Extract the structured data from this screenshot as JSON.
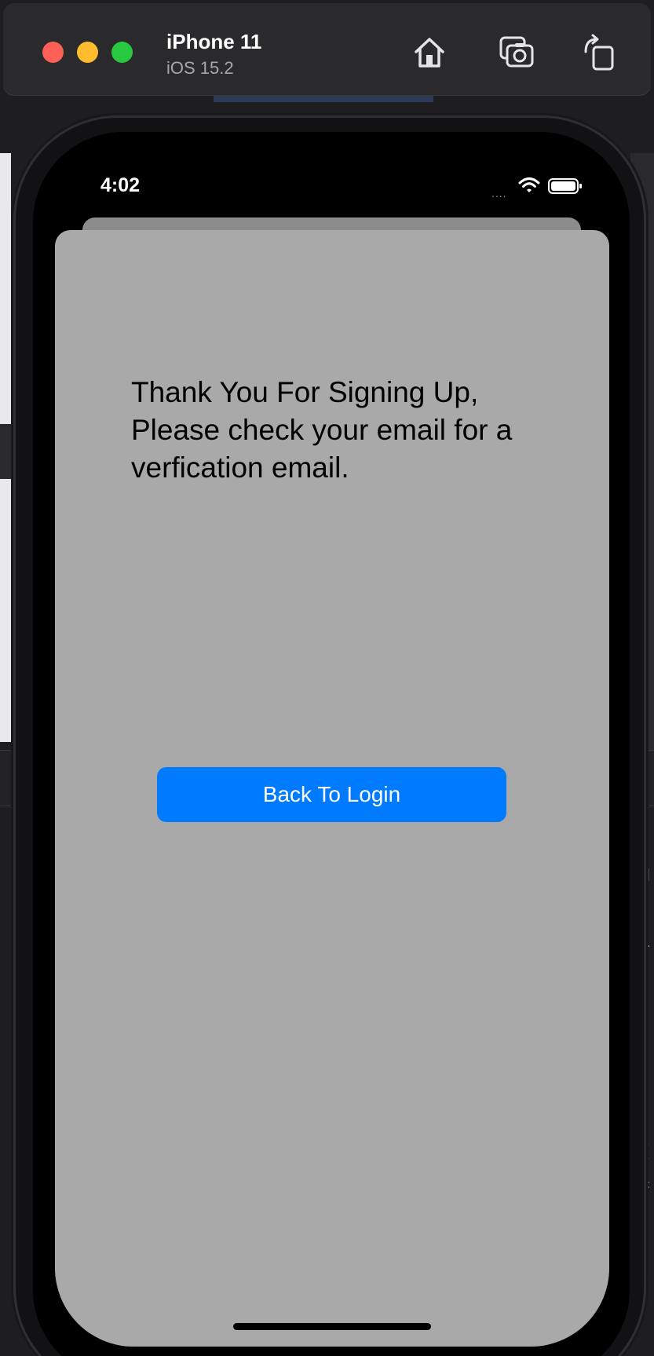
{
  "simulator": {
    "device_name": "iPhone 11",
    "os_version": "iOS 15.2",
    "icons": {
      "home": "home-icon",
      "screenshot": "camera-icon",
      "rotate": "rotate-icon"
    },
    "traffic_lights": [
      "#fe5f57",
      "#febc2e",
      "#28c840"
    ]
  },
  "status_bar": {
    "time": "4:02",
    "signal": "....",
    "icons": [
      "wifi-icon",
      "battery-icon"
    ]
  },
  "screen": {
    "message": "Thank You For Signing Up, Please check your email for a verfication email.",
    "back_button_label": "Back To Login",
    "sheet_color": "#a9a9a9",
    "button_color": "#007aff"
  }
}
